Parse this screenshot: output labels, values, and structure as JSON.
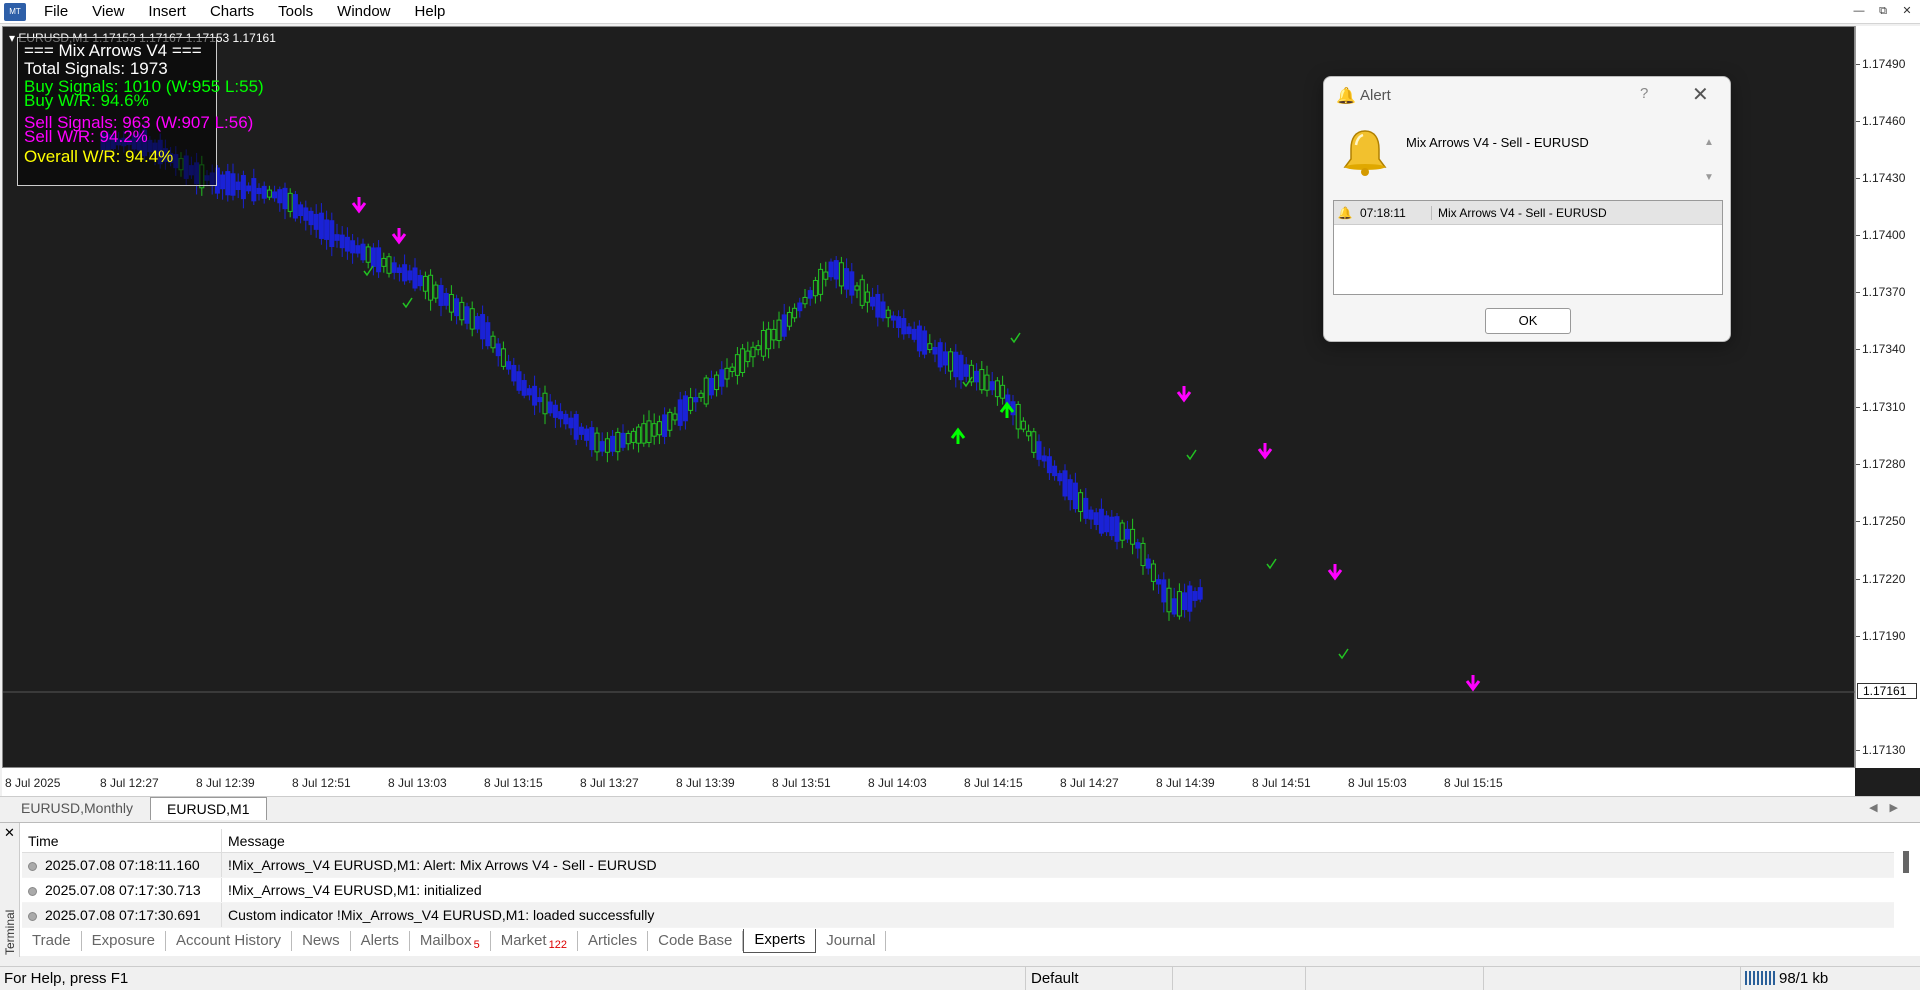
{
  "menu": {
    "items": [
      "File",
      "View",
      "Insert",
      "Charts",
      "Tools",
      "Window",
      "Help"
    ]
  },
  "window_controls": [
    "minimize-icon",
    "restore-icon",
    "close-icon"
  ],
  "chart": {
    "symbol_line": "EURUSD,M1  1.17153 1.17167 1.17153 1.17161",
    "current_price": "1.17161",
    "price_labels": [
      "1.17490",
      "1.17460",
      "1.17430",
      "1.17400",
      "1.17370",
      "1.17340",
      "1.17310",
      "1.17280",
      "1.17250",
      "1.17220",
      "1.17190",
      "1.17130"
    ],
    "time_labels": [
      "8 Jul 2025",
      "8 Jul 12:27",
      "8 Jul 12:39",
      "8 Jul 12:51",
      "8 Jul 13:03",
      "8 Jul 13:15",
      "8 Jul 13:27",
      "8 Jul 13:39",
      "8 Jul 13:51",
      "8 Jul 14:03",
      "8 Jul 14:15",
      "8 Jul 14:27",
      "8 Jul 14:39",
      "8 Jul 14:51",
      "8 Jul 15:03",
      "8 Jul 15:15"
    ],
    "colors": {
      "background": "#1e1e1e",
      "bull": "#22c322",
      "bear": "#1a22d6",
      "sell_arrow": "#ff00ff",
      "buy_arrow": "#00ff00",
      "check": "#22c322"
    }
  },
  "stats": {
    "title": "=== Mix Arrows V4 ===",
    "total": "Total Signals: 1973",
    "buy_signals": "Buy Signals: 1010 (W:955 L:55)",
    "buy_wr": "Buy W/R: 94.6%",
    "sell_signals": "Sell Signals: 963 (W:907 L:56)",
    "sell_wr": "Sell W/R: 94.2%",
    "overall_wr": "Overall W/R: 94.4%",
    "colors": {
      "title": "#ffffff",
      "buy": "#00ff00",
      "sell": "#ff00ff",
      "overall": "#ffff00"
    }
  },
  "chart_tabs": [
    "EURUSD,Monthly",
    "EURUSD,M1"
  ],
  "terminal": {
    "label": "Terminal",
    "columns": [
      "Time",
      "Message"
    ],
    "rows": [
      {
        "time": "2025.07.08 07:18:11.160",
        "message": "!Mix_Arrows_V4 EURUSD,M1: Alert: Mix Arrows V4 - Sell - EURUSD"
      },
      {
        "time": "2025.07.08 07:17:30.713",
        "message": "!Mix_Arrows_V4 EURUSD,M1: initialized"
      },
      {
        "time": "2025.07.08 07:17:30.691",
        "message": "Custom indicator !Mix_Arrows_V4 EURUSD,M1: loaded successfully"
      }
    ],
    "tabs": [
      {
        "label": "Trade",
        "badge": ""
      },
      {
        "label": "Exposure",
        "badge": ""
      },
      {
        "label": "Account History",
        "badge": ""
      },
      {
        "label": "News",
        "badge": ""
      },
      {
        "label": "Alerts",
        "badge": ""
      },
      {
        "label": "Mailbox",
        "badge": "5"
      },
      {
        "label": "Market",
        "badge": "122"
      },
      {
        "label": "Articles",
        "badge": ""
      },
      {
        "label": "Code Base",
        "badge": ""
      },
      {
        "label": "Experts",
        "badge": ""
      },
      {
        "label": "Journal",
        "badge": ""
      }
    ],
    "active_tab": "Experts"
  },
  "status": {
    "help": "For Help, press F1",
    "profile": "Default",
    "traffic": "98/1 kb"
  },
  "alert": {
    "title": "Alert",
    "help": "?",
    "message": "Mix Arrows V4 - Sell - EURUSD",
    "list": [
      {
        "time": "07:18:11",
        "message": "Mix Arrows V4 - Sell - EURUSD"
      }
    ],
    "ok": "OK"
  }
}
